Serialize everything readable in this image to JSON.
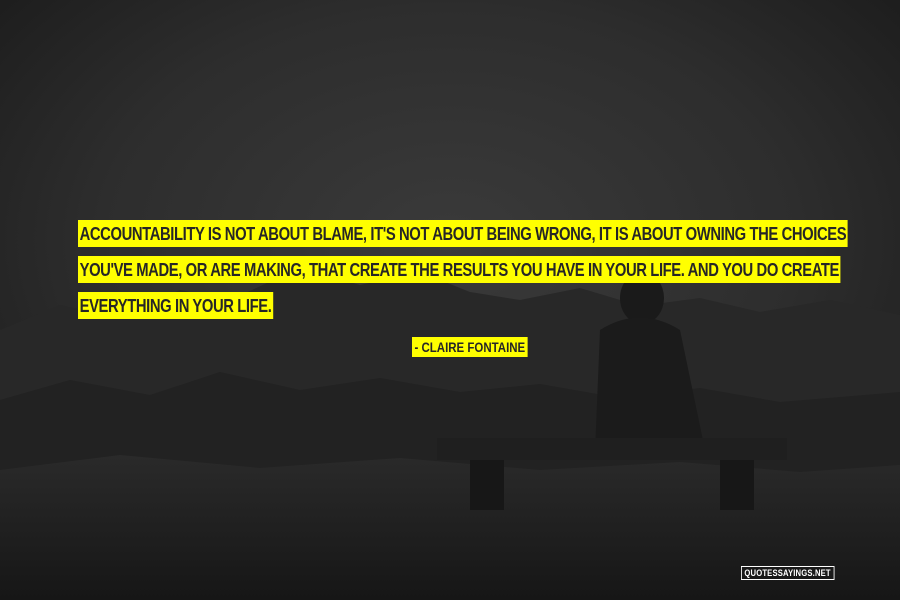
{
  "quote": {
    "lines": [
      "ACCOUNTABILITY IS NOT ABOUT BLAME, IT'S NOT ABOUT BEING WRONG, IT IS ABOUT OWNING THE CHOICES",
      "YOU'VE MADE, OR ARE MAKING, THAT CREATE THE RESULTS YOU HAVE IN YOUR LIFE. AND YOU DO CREATE",
      "EVERYTHING IN YOUR LIFE."
    ],
    "author": "- CLAIRE FONTAINE"
  },
  "watermark": "QUOTESSAYINGS.NET",
  "colors": {
    "highlight": "#ffff00",
    "text": "#262626",
    "background": "#2a2a2a"
  }
}
